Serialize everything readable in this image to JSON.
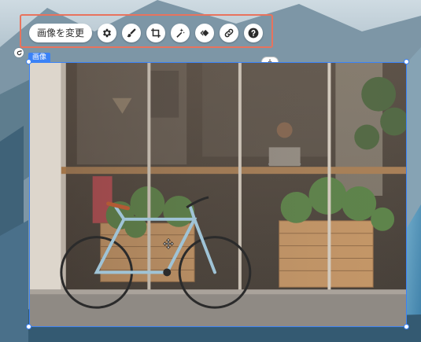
{
  "toolbar": {
    "change_image_label": "画像を変更",
    "buttons": [
      {
        "icon": "gear-icon",
        "name": "settings-button"
      },
      {
        "icon": "pen-icon",
        "name": "edit-button"
      },
      {
        "icon": "crop-icon",
        "name": "crop-button"
      },
      {
        "icon": "magic-wand-icon",
        "name": "enhance-button"
      },
      {
        "icon": "animation-icon",
        "name": "animation-button"
      },
      {
        "icon": "link-icon",
        "name": "link-button"
      },
      {
        "icon": "help-icon",
        "name": "help-button"
      }
    ]
  },
  "selection": {
    "label": "画像"
  },
  "colors": {
    "selection_blue": "#3b82f6",
    "toolbar_highlight": "#e8735d"
  }
}
